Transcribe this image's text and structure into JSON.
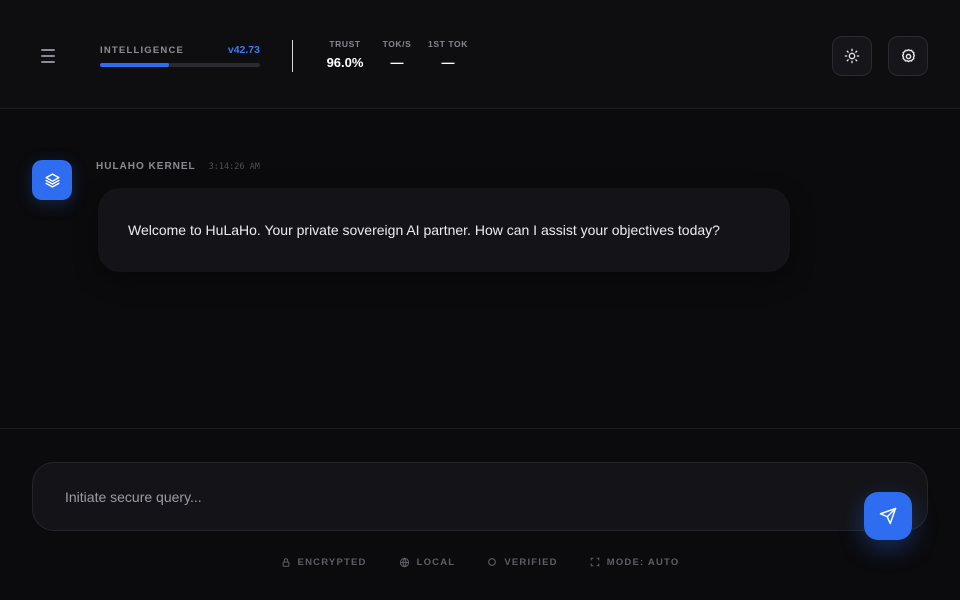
{
  "header": {
    "menu_icon": "hamburger-menu-icon",
    "intelligence": {
      "label": "INTELLIGENCE",
      "version": "v42.73",
      "progress_fraction": 0.43
    },
    "stats": [
      {
        "label": "TRUST",
        "value": "96.0%"
      },
      {
        "label": "TOK/S",
        "value": "—"
      },
      {
        "label": "1ST TOK",
        "value": "—"
      }
    ],
    "theme_icon": "sun-icon",
    "settings_icon": "gear-icon"
  },
  "chat": {
    "messages": [
      {
        "sender": "HULAHO KERNEL",
        "timestamp": "3:14:26 AM",
        "avatar_icon": "layers-icon",
        "text": "Welcome to HuLaHo. Your private sovereign AI partner. How can I assist your objectives today?"
      }
    ]
  },
  "composer": {
    "placeholder": "Initiate secure query...",
    "value": "",
    "send_icon": "paper-plane-icon"
  },
  "footer": {
    "items": [
      {
        "label": "ENCRYPTED",
        "icon": "lock-icon"
      },
      {
        "label": "LOCAL",
        "icon": "globe-icon"
      },
      {
        "label": "VERIFIED",
        "icon": "circle-icon"
      },
      {
        "label": "MODE: AUTO",
        "icon": "expand-icon"
      }
    ]
  },
  "colors": {
    "accent": "#2f6df0",
    "background": "#0b0b0d",
    "surface": "#141418"
  }
}
